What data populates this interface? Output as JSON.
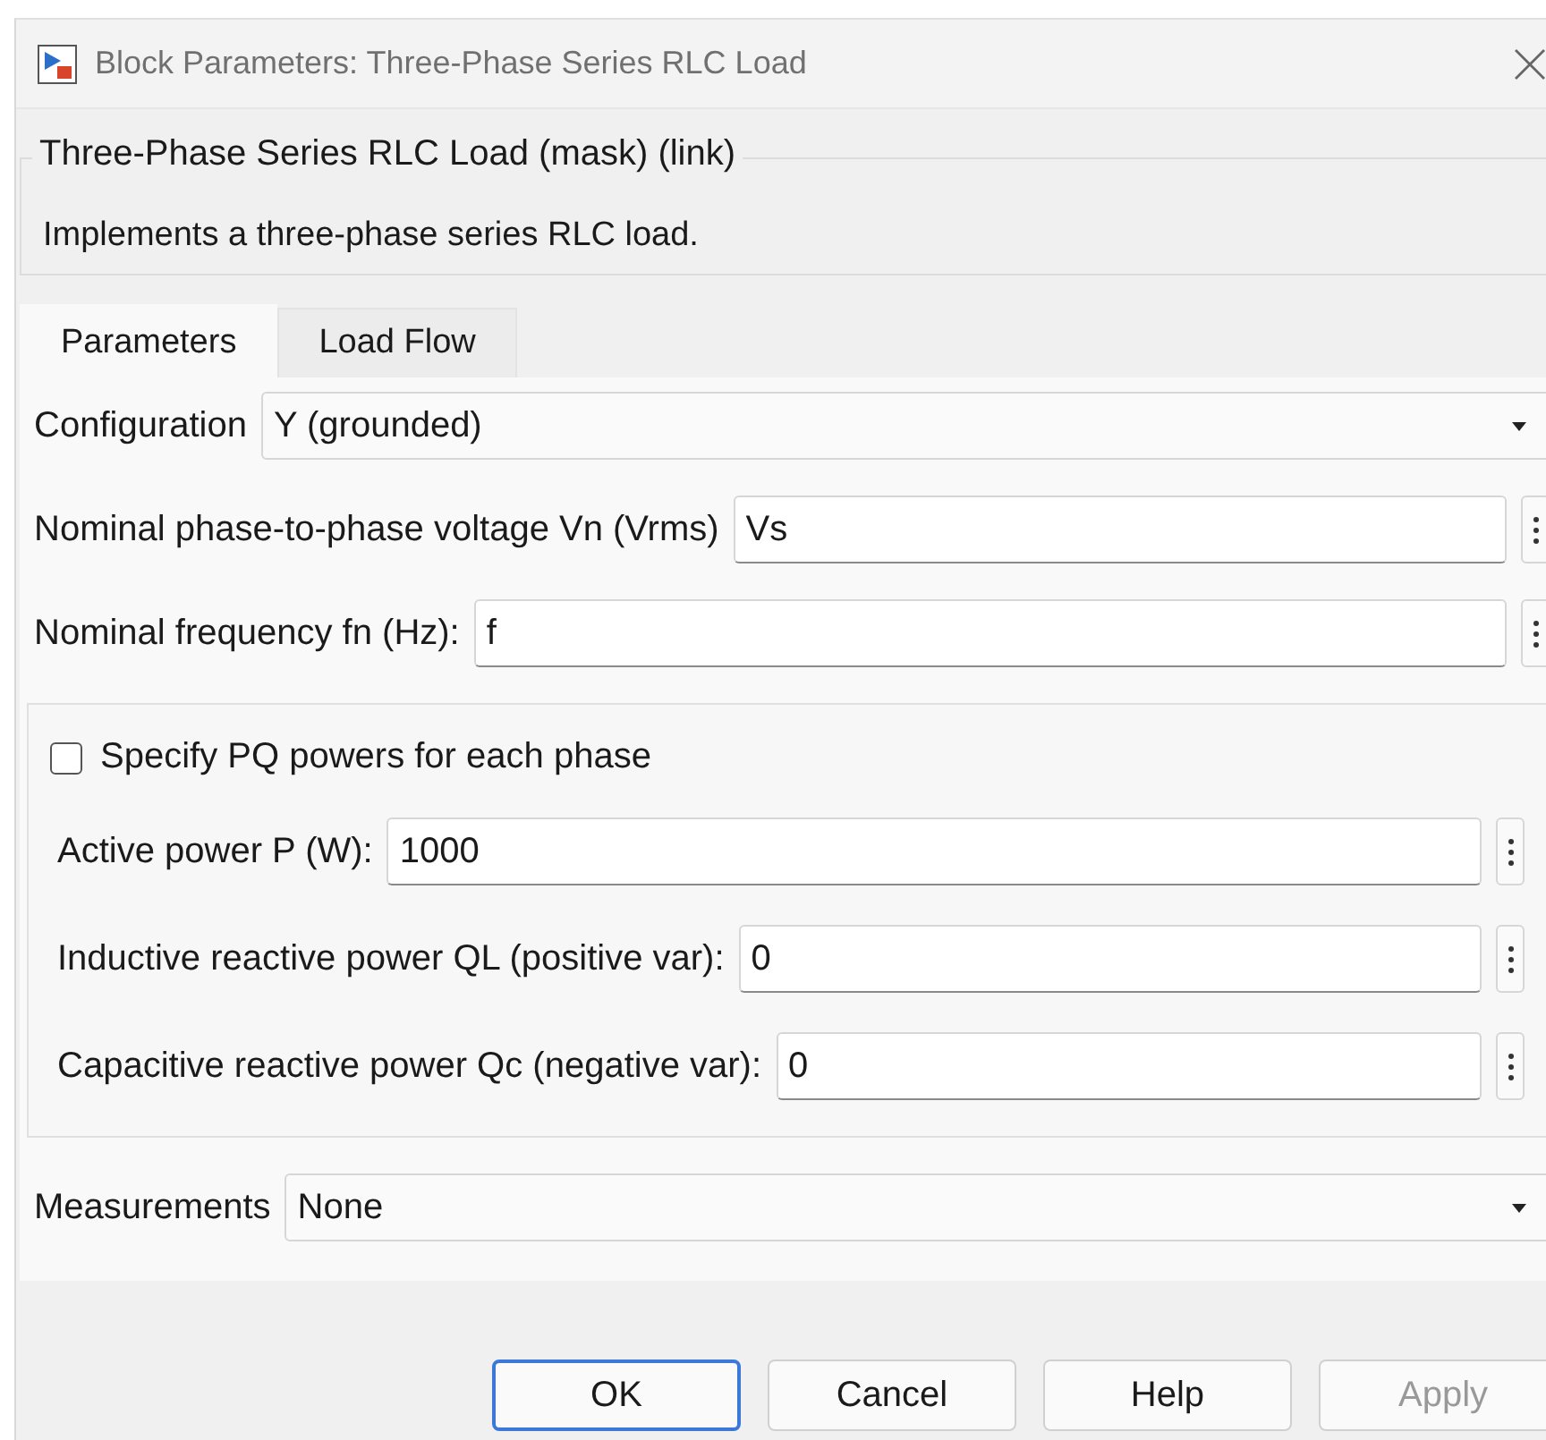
{
  "window": {
    "title": "Block Parameters: Three-Phase Series RLC Load"
  },
  "mask": {
    "title": "Three-Phase Series RLC Load (mask) (link)",
    "description": "Implements a three-phase series RLC load."
  },
  "tabs": [
    {
      "label": "Parameters",
      "selected": true
    },
    {
      "label": "Load Flow",
      "selected": false
    }
  ],
  "parameters": [
    {
      "kind": "dropdown",
      "label": "Configuration",
      "value": "Y (grounded)"
    },
    {
      "kind": "text",
      "label": "Nominal phase-to-phase voltage Vn (Vrms)",
      "value": "Vs"
    },
    {
      "kind": "text",
      "label": "Nominal frequency fn (Hz):",
      "value": "f"
    },
    {
      "kind": "group",
      "checkbox": {
        "label": "Specify PQ powers for each phase",
        "checked": false
      },
      "children": [
        {
          "kind": "text",
          "label": "Active power P (W):",
          "value": "1000"
        },
        {
          "kind": "text",
          "label": "Inductive reactive power QL (positive var):",
          "value": "0"
        },
        {
          "kind": "text",
          "label": "Capacitive reactive power Qc (negative var):",
          "value": "0"
        }
      ]
    },
    {
      "kind": "dropdown",
      "label": "Measurements",
      "value": "None"
    }
  ],
  "buttons": [
    {
      "label": "OK",
      "focused": true,
      "disabled": false
    },
    {
      "label": "Cancel",
      "focused": false,
      "disabled": false
    },
    {
      "label": "Help",
      "focused": false,
      "disabled": false
    },
    {
      "label": "Apply",
      "focused": false,
      "disabled": true
    }
  ]
}
